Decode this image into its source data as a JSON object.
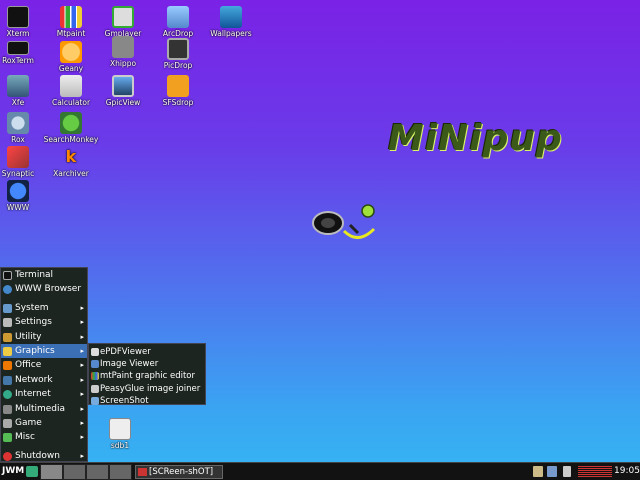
{
  "desktop": {
    "icons": [
      {
        "label": "Xterm"
      },
      {
        "label": "Mtpaint"
      },
      {
        "label": "Gmplayer"
      },
      {
        "label": "ArcDrop"
      },
      {
        "label": "Wallpapers"
      },
      {
        "label": "RoxTerm"
      },
      {
        "label": "Geany"
      },
      {
        "label": "Xhippo"
      },
      {
        "label": "PicDrop"
      },
      {
        "label": "Xfe"
      },
      {
        "label": "Calculator"
      },
      {
        "label": "GpicView"
      },
      {
        "label": "SFSdrop"
      },
      {
        "label": "Rox"
      },
      {
        "label": "SearchMonkey"
      },
      {
        "label": "Synaptic"
      },
      {
        "label": "Xarchiver"
      },
      {
        "label": "WWW"
      },
      {
        "label": "sdb1"
      }
    ],
    "logo_text": "MiNipup"
  },
  "menu": {
    "items": [
      {
        "label": "Terminal"
      },
      {
        "label": "WWW Browser"
      },
      {
        "label": "System"
      },
      {
        "label": "Settings"
      },
      {
        "label": "Utility"
      },
      {
        "label": "Graphics"
      },
      {
        "label": "Office"
      },
      {
        "label": "Network"
      },
      {
        "label": "Internet"
      },
      {
        "label": "Multimedia"
      },
      {
        "label": "Game"
      },
      {
        "label": "Misc"
      },
      {
        "label": "Shutdown"
      }
    ],
    "arrow": "▸",
    "graphics_submenu": [
      {
        "label": "ePDFViewer"
      },
      {
        "label": "Image Viewer"
      },
      {
        "label": "mtPaint graphic editor"
      },
      {
        "label": "PeasyGlue image joiner"
      },
      {
        "label": "ScreenShot"
      }
    ]
  },
  "taskbar": {
    "start_label": "JWM",
    "task_label": "[SCReen-shOT]",
    "clock": "19:05"
  },
  "colors": {
    "menu_bg": "#1c2520",
    "menu_selected": "#3b6fb6",
    "taskbar_bg": "#121212"
  }
}
